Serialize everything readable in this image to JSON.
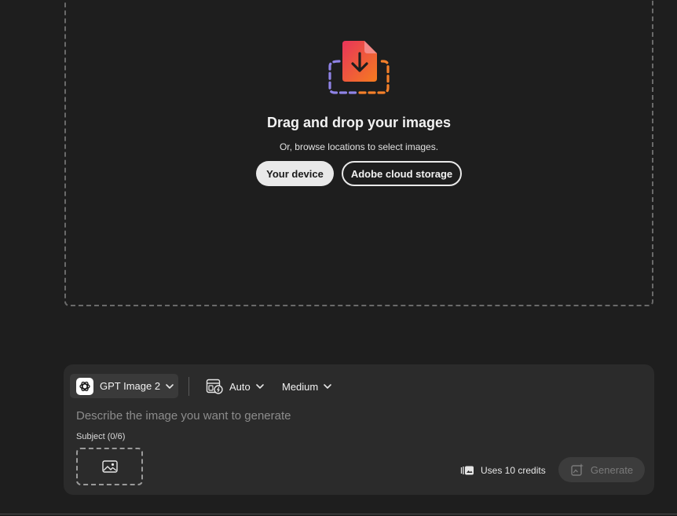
{
  "dropzone": {
    "title": "Drag and drop your images",
    "subtitle": "Or, browse locations to select images.",
    "device_button": "Your device",
    "cloud_button": "Adobe cloud storage",
    "illustration_icon": "upload-file-icon"
  },
  "composer": {
    "model": {
      "label": "GPT Image 2",
      "icon": "openai-logo-icon"
    },
    "aspect": {
      "label": "Auto",
      "icon": "aspect-ratio-icon"
    },
    "quality": {
      "label": "Medium"
    },
    "prompt": {
      "placeholder": "Describe the image you want to generate",
      "value": ""
    },
    "subject": {
      "label": "Subject (0/6)",
      "add_icon": "image-icon"
    },
    "credits": {
      "label": "Uses 10 credits",
      "icon": "credits-icon"
    },
    "generate": {
      "label": "Generate",
      "icon": "generate-icon",
      "enabled": false
    }
  },
  "colors": {
    "background": "#1e1e1e",
    "panel": "#2b2b2b",
    "accent_gradient_start": "#e8345a",
    "accent_gradient_end": "#f57c1f",
    "dashed_purple": "#8f83e6",
    "dashed_orange": "#f5802a"
  }
}
